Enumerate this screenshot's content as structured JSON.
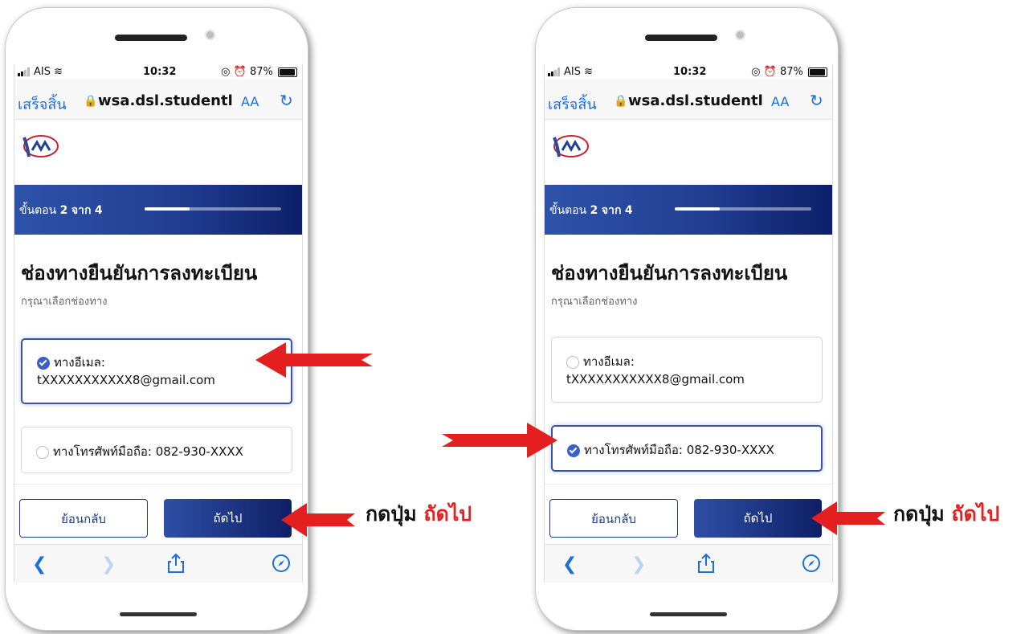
{
  "screens": [
    {
      "status": {
        "carrier": "AIS",
        "time": "10:32",
        "battery": "87%"
      },
      "browser": {
        "done_label": "เสร็จสิ้น",
        "url": "wsa.dsl.studentl",
        "aa_label": "AA"
      },
      "banner": {
        "step_prefix": "ขั้นตอน",
        "step_current": "2",
        "step_sep": "จาก",
        "step_total": "4",
        "progress": 0.33
      },
      "heading": "ช่องทางยืนยันการลงทะเบียน",
      "subtitle": "กรุณาเลือกช่องทาง",
      "email_option": {
        "label": "ทางอีเมล:",
        "value": "tXXXXXXXXXXX8@gmail.com",
        "selected": true
      },
      "phone_option": {
        "label": "ทางโทรศัพท์มือถือ: 082-930-XXXX",
        "selected": false
      },
      "back_label": "ย้อนกลับ",
      "next_label": "ถัดไป"
    },
    {
      "status": {
        "carrier": "AIS",
        "time": "10:32",
        "battery": "87%"
      },
      "browser": {
        "done_label": "เสร็จสิ้น",
        "url": "wsa.dsl.studentl",
        "aa_label": "AA"
      },
      "banner": {
        "step_prefix": "ขั้นตอน",
        "step_current": "2",
        "step_sep": "จาก",
        "step_total": "4",
        "progress": 0.33
      },
      "heading": "ช่องทางยืนยันการลงทะเบียน",
      "subtitle": "กรุณาเลือกช่องทาง",
      "email_option": {
        "label": "ทางอีเมล:",
        "value": "tXXXXXXXXXXX8@gmail.com",
        "selected": false
      },
      "phone_option": {
        "label": "ทางโทรศัพท์มือถือ: 082-930-XXXX",
        "selected": true
      },
      "back_label": "ย้อนกลับ",
      "next_label": "ถัดไป"
    }
  ],
  "instruction": {
    "prefix": "กดปุ่ม",
    "highlight": "ถัดไป"
  },
  "colors": {
    "accent_blue": "#1a6fe0",
    "banner_dark": "#0d1f6a",
    "arrow_red": "#e41f1f"
  }
}
